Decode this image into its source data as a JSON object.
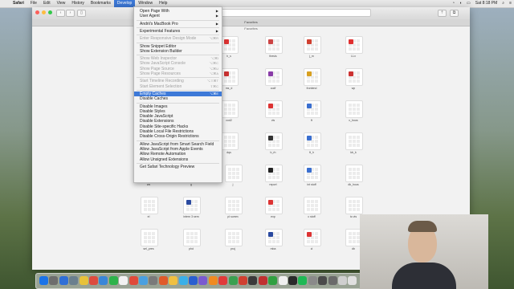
{
  "menubar": {
    "app": "Safari",
    "items": [
      "File",
      "Edit",
      "View",
      "History",
      "Bookmarks",
      "Develop",
      "Window",
      "Help"
    ],
    "active": "Develop",
    "clock": "Sat 8:18 PM"
  },
  "tab": {
    "title": "Favorites"
  },
  "favorites": {
    "title": "Favorites",
    "tiles": [
      {
        "label": "h_s"
      },
      {
        "label": "thesis"
      },
      {
        "label": "j_m"
      },
      {
        "label": "LLx"
      },
      {
        "label": "ms_d"
      },
      {
        "label": "codf"
      },
      {
        "label": "frontend"
      },
      {
        "label": "wp"
      },
      {
        "label": "cod2"
      },
      {
        "label": "vis"
      },
      {
        "label": "ft"
      },
      {
        "label": "c_hous"
      },
      {
        "label": "dqs"
      },
      {
        "label": "b_rh"
      },
      {
        "label": "ft_h"
      },
      {
        "label": "kb_k"
      },
      {
        "label": "ws"
      },
      {
        "label": "g"
      },
      {
        "label": "j"
      },
      {
        "label": "report"
      },
      {
        "label": "int stuff"
      },
      {
        "label": "dk_hous"
      },
      {
        "label": "el"
      },
      {
        "label": "intern 3 sem"
      },
      {
        "label": "pl summ"
      },
      {
        "label": "exp"
      },
      {
        "label": "c stuff"
      },
      {
        "label": "to vis"
      },
      {
        "label": "sel_pres"
      },
      {
        "label": "phd"
      },
      {
        "label": "proj"
      },
      {
        "label": "mba"
      },
      {
        "label": "cl"
      },
      {
        "label": "db"
      }
    ]
  },
  "develop_menu": {
    "items": [
      {
        "label": "Open Page With",
        "submenu": true
      },
      {
        "label": "User Agent",
        "submenu": true
      },
      {
        "sep": true
      },
      {
        "label": "Andrii's MacBook Pro",
        "submenu": true
      },
      {
        "sep": true
      },
      {
        "label": "Experimental Features",
        "submenu": true
      },
      {
        "sep": true
      },
      {
        "label": "Enter Responsive Design Mode",
        "shortcut": "⌥⌘R",
        "disabled": true
      },
      {
        "sep": true
      },
      {
        "label": "Show Snippet Editor"
      },
      {
        "label": "Show Extension Builder"
      },
      {
        "sep": true
      },
      {
        "label": "Show Web Inspector",
        "shortcut": "⌥⌘I",
        "disabled": true
      },
      {
        "label": "Show JavaScript Console",
        "shortcut": "⌥⌘C",
        "disabled": true
      },
      {
        "label": "Show Page Source",
        "shortcut": "⌥⌘U",
        "disabled": true
      },
      {
        "label": "Show Page Resources",
        "shortcut": "⌥⌘A",
        "disabled": true
      },
      {
        "sep": true
      },
      {
        "label": "Start Timeline Recording",
        "shortcut": "⌥⇧⌘T",
        "disabled": true
      },
      {
        "label": "Start Element Selection",
        "shortcut": "⇧⌘C",
        "disabled": true
      },
      {
        "sep": true
      },
      {
        "label": "Empty Caches",
        "shortcut": "⌥⌘E",
        "highlighted": true
      },
      {
        "label": "Disable Caches"
      },
      {
        "sep": true
      },
      {
        "label": "Disable Images"
      },
      {
        "label": "Disable Styles"
      },
      {
        "label": "Disable JavaScript"
      },
      {
        "label": "Disable Extensions"
      },
      {
        "label": "Disable Site-specific Hacks"
      },
      {
        "label": "Disable Local File Restrictions"
      },
      {
        "label": "Disable Cross-Origin Restrictions"
      },
      {
        "sep": true
      },
      {
        "label": "Allow JavaScript from Smart Search Field"
      },
      {
        "label": "Allow JavaScript from Apple Events"
      },
      {
        "label": "Allow Remote Automation"
      },
      {
        "label": "Allow Unsigned Extensions"
      },
      {
        "sep": true
      },
      {
        "label": "Get Safari Technology Preview"
      }
    ]
  },
  "colors": {
    "highlight": "#3d79d8",
    "menubar": "#e9e9e9"
  }
}
